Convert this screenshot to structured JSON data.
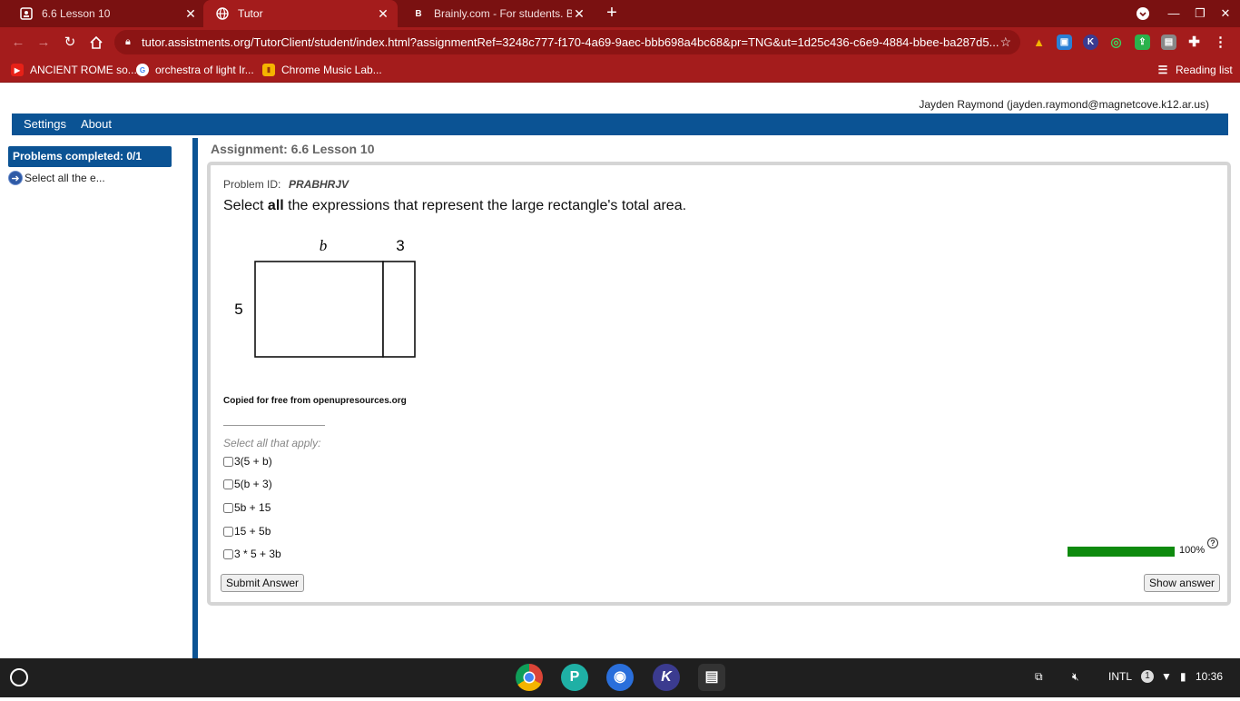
{
  "browser": {
    "tabs": [
      {
        "title": "6.6 Lesson 10",
        "icon": "assignment-icon",
        "active": false
      },
      {
        "title": "Tutor",
        "icon": "globe-icon",
        "active": true
      },
      {
        "title": "Brainly.com - For students. By st",
        "icon": "brainly-icon",
        "active": false
      }
    ],
    "url": "tutor.assistments.org/TutorClient/student/index.html?assignmentRef=3248c777-f170-4a69-9aec-bbb698a4bc68&pr=TNG&ut=1d25c436-c6e9-4884-bbee-ba287d5...",
    "bookmarks": [
      {
        "label": "ANCIENT ROME so...",
        "icon": "youtube-icon"
      },
      {
        "label": "orchestra of light Ir...",
        "icon": "google-icon"
      },
      {
        "label": "Chrome Music Lab...",
        "icon": "music-lab-icon"
      }
    ],
    "reading_list": "Reading list"
  },
  "user": {
    "display": "Jayden Raymond (jayden.raymond@magnetcove.k12.ar.us)"
  },
  "nav": {
    "settings": "Settings",
    "about": "About"
  },
  "sidebar": {
    "header": "Problems completed: 0/1",
    "item": "Select all the e..."
  },
  "assignment": {
    "title": "Assignment: 6.6 Lesson 10"
  },
  "problem": {
    "id_label": "Problem ID:",
    "id": "PRABHRJV",
    "question_pre": "Select ",
    "question_bold": "all",
    "question_post": " the expressions that represent the large rectangle's total area.",
    "diagram": {
      "top_left": "b",
      "top_right": "3",
      "side": "5"
    },
    "credit": "Copied for free from openupresources.org",
    "select_note": "Select all that apply:",
    "choices": [
      "3(5 + b)",
      "5(b + 3)",
      "5b + 15",
      "15 + 5b",
      "3 * 5 + 3b"
    ],
    "progress_percent": 100,
    "progress_label": "100%",
    "submit": "Submit Answer",
    "show_answer": "Show answer"
  },
  "taskbar": {
    "apps": [
      "chrome-icon",
      "pear-deck-icon",
      "camera-icon",
      "kami-icon",
      "files-icon"
    ],
    "ime": "INTL",
    "notifications": "1",
    "time": "10:36"
  },
  "colors": {
    "tabbar": "#7a1111",
    "chrome": "#a41c1c",
    "accent": "#0b5394",
    "progress": "#0e8a0e"
  }
}
